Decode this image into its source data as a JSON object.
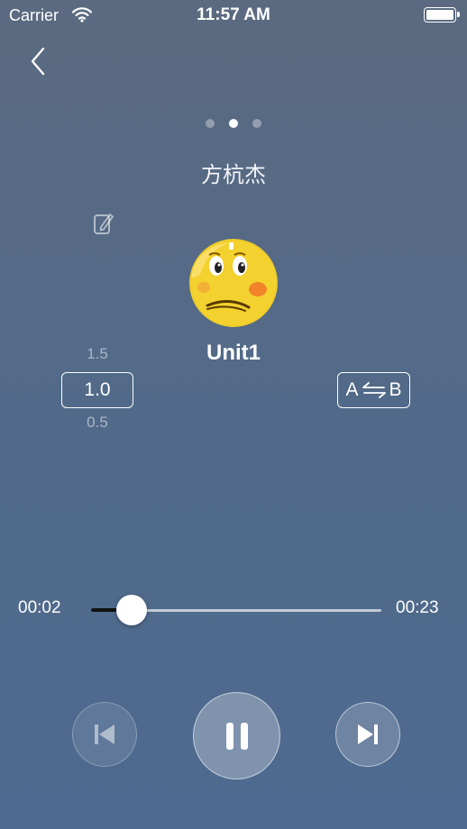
{
  "status_bar": {
    "carrier": "Carrier",
    "time": "11:57 AM",
    "battery": "full"
  },
  "nav": {
    "back_icon": "chevron-left-icon"
  },
  "pager": {
    "count": 3,
    "active_index": 1
  },
  "title": "方杭杰",
  "lesson": {
    "name": "Unit1",
    "avatar_icon": "emoji-avatar"
  },
  "speed": {
    "higher": "1.5",
    "current": "1.0",
    "lower": "0.5"
  },
  "ab_repeat": {
    "a": "A",
    "b": "B",
    "icon": "swap-arrows-icon"
  },
  "playback": {
    "elapsed": "00:02",
    "total": "00:23",
    "progress": 0.14,
    "state": "playing"
  },
  "controls": {
    "prev_icon": "skip-previous-icon",
    "pause_icon": "pause-icon",
    "next_icon": "skip-next-icon"
  },
  "colors": {
    "accent": "#ffffff",
    "track_done": "#111111"
  }
}
